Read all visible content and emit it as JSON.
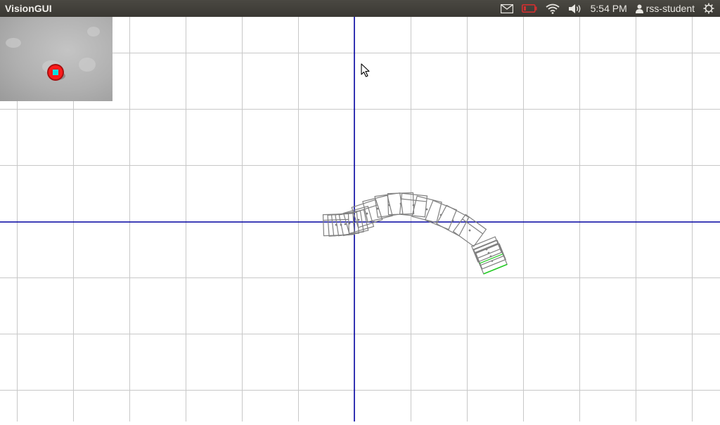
{
  "topbar": {
    "app_title": "VisionGUI",
    "time": "5:54 PM",
    "username": "rss-student"
  },
  "icons": {
    "mail": "envelope-icon",
    "battery": "battery-low-icon",
    "wifi": "wifi-icon",
    "volume": "volume-icon",
    "user": "user-icon",
    "settings": "gear-power-icon",
    "cursor": "mouse-pointer-icon"
  },
  "colors": {
    "topbar_bg": "#3c3b37",
    "grid_line": "#c8c8c8",
    "axis_line": "#0000a0",
    "pose_outline": "#808080",
    "current_pose": "#22cc22",
    "blob_marker": "#ff1a1a",
    "blob_center": "#00e0e0",
    "battery_warn": "#d03030"
  },
  "camera_inset": {
    "label": "camera-view",
    "detected_blob": true
  }
}
